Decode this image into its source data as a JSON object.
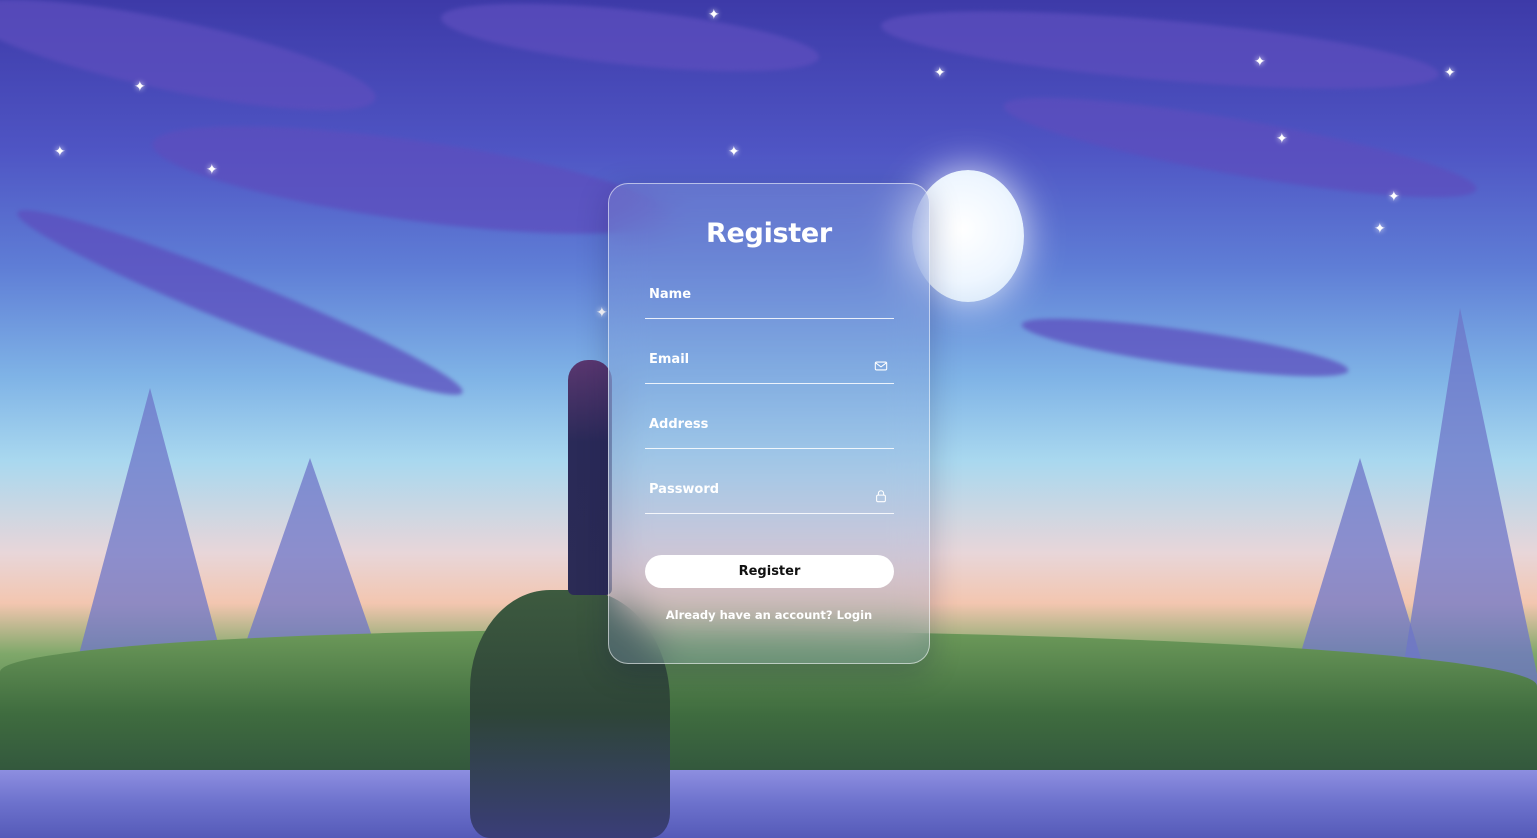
{
  "form": {
    "title": "Register",
    "fields": {
      "name": {
        "label": "Name",
        "value": ""
      },
      "email": {
        "label": "Email",
        "value": "",
        "icon": "envelope-icon"
      },
      "address": {
        "label": "Address",
        "value": ""
      },
      "password": {
        "label": "Password",
        "value": "",
        "icon": "lock-icon"
      }
    },
    "submit_label": "Register",
    "footer": {
      "prompt": "Already have an account?",
      "link_label": "Login"
    }
  },
  "colors": {
    "card_border": "#ffffff",
    "button_bg": "#ffffff",
    "button_text": "#111111",
    "text": "#ffffff"
  }
}
